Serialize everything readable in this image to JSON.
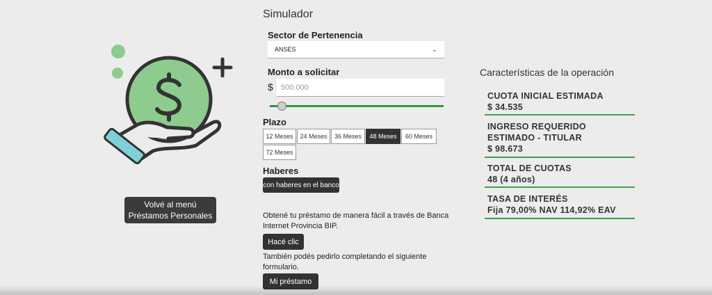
{
  "left": {
    "back_button_line1": "Volvé al menú",
    "back_button_line2": "Préstamos Personales",
    "illustration_icon": "hand-holding-dollar-coin"
  },
  "simulator": {
    "title": "Simulador",
    "sector_label": "Sector de Pertenencia",
    "sector_value": "ANSES",
    "amount_label": "Monto a solicitar",
    "currency_symbol": "$",
    "amount_placeholder": "500.000",
    "slider_level_fraction": 0.07,
    "plazo_label": "Plazo",
    "plazo_options": [
      "12 Meses",
      "24 Meses",
      "36 Meses",
      "48 Meses",
      "60 Meses",
      "72 Meses"
    ],
    "plazo_selected": "48 Meses",
    "haberes_label": "Haberes",
    "haberes_option": "con haberes en el banco",
    "bip_text": "Obtené tu préstamo de manera fácil a través de Banca Internet Provincia BIP.",
    "bip_button": "Hacé clic",
    "form_text": "También podés pedirlo completando el siguiente formulario.",
    "form_button": "Mi préstamo"
  },
  "characteristics": {
    "title": "Características de la operación",
    "items": [
      {
        "label": "CUOTA INICIAL ESTIMADA",
        "value": "$ 34.535"
      },
      {
        "label": "INGRESO REQUERIDO ESTIMADO - TITULAR",
        "value": "$ 98.673"
      },
      {
        "label": "TOTAL DE CUOTAS",
        "value": "48 (4 años)"
      },
      {
        "label": "TASA DE INTERÉS",
        "value": "Fija 79,00% NAV 114,92% EAV"
      }
    ]
  },
  "colors": {
    "accent_green": "#2a9a3a",
    "coin_green": "#8ecb8e",
    "dark_button": "#333333",
    "cuff_teal": "#7fd0d6"
  }
}
